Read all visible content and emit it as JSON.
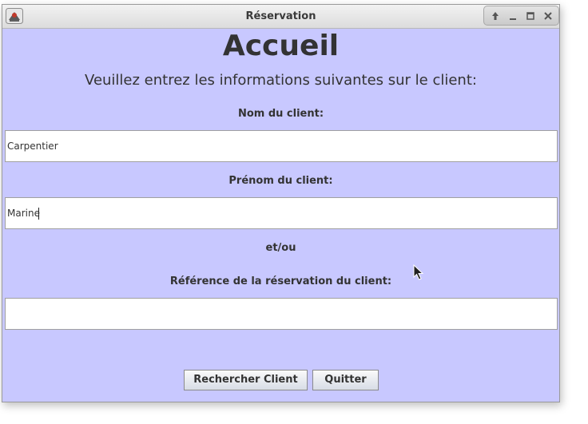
{
  "window": {
    "title": "Réservation",
    "controls": [
      "up-arrow-icon",
      "minimize-icon",
      "maximize-icon",
      "close-icon"
    ]
  },
  "header": {
    "title": "Accueil",
    "subtitle": "Veuillez entrez les informations suivantes sur le client:"
  },
  "form": {
    "nom_label": "Nom du client:",
    "nom_value": "Carpentier",
    "prenom_label": "Prénom du client:",
    "prenom_value": "Marine",
    "separator": "et/ou",
    "reference_label": "Référence de la réservation du client:",
    "reference_value": ""
  },
  "buttons": {
    "search_label": "Rechercher Client",
    "quit_label": "Quitter"
  },
  "colors": {
    "background": "#c8c8ff",
    "text": "#333333"
  }
}
